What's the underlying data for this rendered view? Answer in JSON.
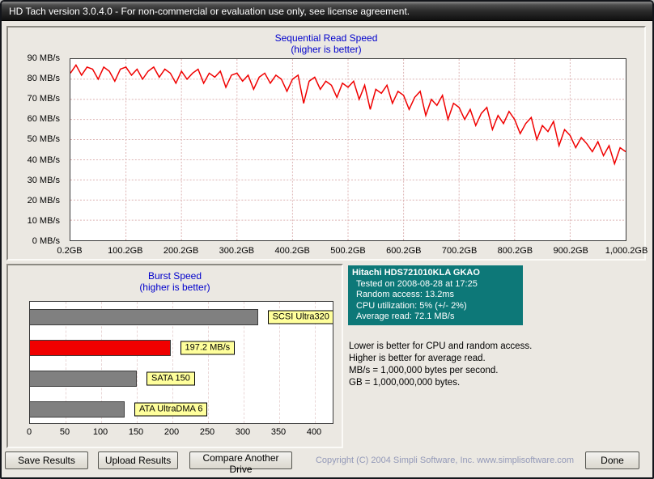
{
  "window": {
    "title": "HD Tach version 3.0.4.0  - For non-commercial or evaluation use only, see license agreement."
  },
  "chart_data": [
    {
      "type": "line",
      "title": "Sequential Read Speed",
      "subtitle": "(higher is better)",
      "x_range_gb": [
        0.2,
        1000.2
      ],
      "x_tick_labels": [
        "0.2GB",
        "100.2GB",
        "200.2GB",
        "300.2GB",
        "400.2GB",
        "500.2GB",
        "600.2GB",
        "700.2GB",
        "800.2GB",
        "900.2GB",
        "1,000.2GB"
      ],
      "y_ticks": [
        0,
        10,
        20,
        30,
        40,
        50,
        60,
        70,
        80,
        90
      ],
      "y_tick_suffix": " MB/s",
      "ylim": [
        0,
        90
      ],
      "grid": true,
      "line_color": "#f00000",
      "series": [
        {
          "name": "Sequential read speed (MB/s)",
          "values": [
            83,
            87,
            82,
            86,
            85,
            80,
            86,
            84,
            79,
            85,
            86,
            82,
            85,
            80,
            84,
            86,
            81,
            85,
            83,
            78,
            84,
            80,
            83,
            85,
            78,
            83,
            81,
            84,
            76,
            82,
            83,
            79,
            82,
            75,
            81,
            83,
            78,
            82,
            80,
            74,
            80,
            82,
            68,
            79,
            81,
            75,
            79,
            77,
            71,
            78,
            76,
            79,
            70,
            77,
            65,
            75,
            73,
            77,
            68,
            74,
            72,
            65,
            71,
            74,
            62,
            70,
            67,
            72,
            60,
            68,
            66,
            60,
            65,
            57,
            63,
            66,
            55,
            62,
            58,
            64,
            60,
            53,
            58,
            61,
            50,
            57,
            54,
            59,
            47,
            55,
            52,
            46,
            51,
            48,
            44,
            49,
            42,
            47,
            38,
            46,
            44
          ]
        }
      ]
    },
    {
      "type": "bar",
      "title": "Burst Speed",
      "subtitle": "(higher is better)",
      "xlim": [
        0,
        400
      ],
      "x_ticks": [
        0,
        50,
        100,
        150,
        200,
        250,
        300,
        350,
        400
      ],
      "label_box_color": "#ffff9c",
      "bars": [
        {
          "label": "SCSI Ultra320",
          "value": 320,
          "color": "#808080"
        },
        {
          "label": "197.2 MB/s",
          "value": 197.2,
          "color": "#f00000"
        },
        {
          "label": "SATA 150",
          "value": 150,
          "color": "#808080"
        },
        {
          "label": "ATA UltraDMA 6",
          "value": 133,
          "color": "#808080"
        }
      ]
    }
  ],
  "info": {
    "drive": "Hitachi HDS721010KLA GKAO",
    "tested": "Tested on 2008-08-28 at 17:25",
    "random_access": "Random access: 13.2ms",
    "cpu_utilization": "CPU utilization: 5% (+/- 2%)",
    "average_read": "Average read: 72.1 MB/s",
    "notes": [
      "Lower is better for CPU and random access.",
      "Higher is better for average read.",
      "MB/s = 1,000,000 bytes per second.",
      "GB = 1,000,000,000 bytes."
    ]
  },
  "buttons": {
    "save": "Save Results",
    "upload": "Upload Results",
    "compare": "Compare Another Drive",
    "done": "Done"
  },
  "footer": {
    "copyright": "Copyright (C) 2004 Simpli Software, Inc.  www.simplisoftware.com"
  },
  "colors": {
    "chart_title_blue": "#0000cc",
    "teal_background": "#0d7878",
    "window_background": "#ebe8e2",
    "copyright_text": "#9399b8"
  }
}
